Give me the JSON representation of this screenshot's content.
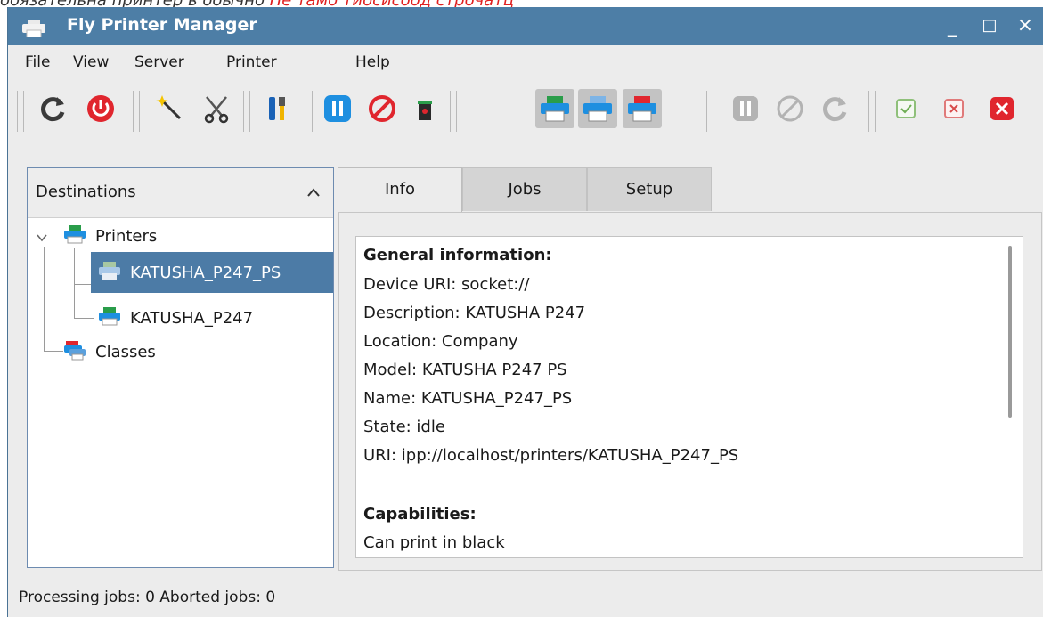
{
  "window": {
    "title": "Fly Printer Manager",
    "minimize": "_",
    "maximize": "□",
    "close": "×"
  },
  "menu": [
    "File",
    "View",
    "Server",
    "Printer",
    "Help"
  ],
  "toolbar": {
    "icons": [
      "refresh-icon",
      "power-icon",
      "magic-wand-icon",
      "scissors-icon",
      "tools-icon",
      "pause-icon",
      "stop-icon",
      "trash-icon",
      "printer-default-icon",
      "printer-blue-icon",
      "printer-red-icon",
      "pause-disabled-icon",
      "stop-disabled-icon",
      "refresh-disabled-icon",
      "accept-icon",
      "reject-icon",
      "close-red-icon"
    ]
  },
  "destinations": {
    "header": "Destinations",
    "printers_label": "Printers",
    "printer_items": [
      "KATUSHA_P247_PS",
      "KATUSHA_P247"
    ],
    "classes_label": "Classes"
  },
  "tabs": [
    "Info",
    "Jobs",
    "Setup"
  ],
  "info": {
    "general_heading": "General information:",
    "device_uri": "Device URI: socket://",
    "description": "Description: KATUSHA P247",
    "location": "Location: Company",
    "model": "Model: KATUSHA P247 PS",
    "name": "Name: KATUSHA_P247_PS",
    "state": "State: idle",
    "uri": "URI: ipp://localhost/printers/KATUSHA_P247_PS",
    "capabilities_heading": "Capabilities:",
    "can_print": "Can print in black"
  },
  "status": "Processing jobs: 0  Aborted jobs: 0",
  "colors": {
    "titlebar": "#4d7ea6",
    "selection": "#4c7ba6",
    "toolbar_blue": "#1e8fe0",
    "toolbar_red": "#e02a2a"
  }
}
